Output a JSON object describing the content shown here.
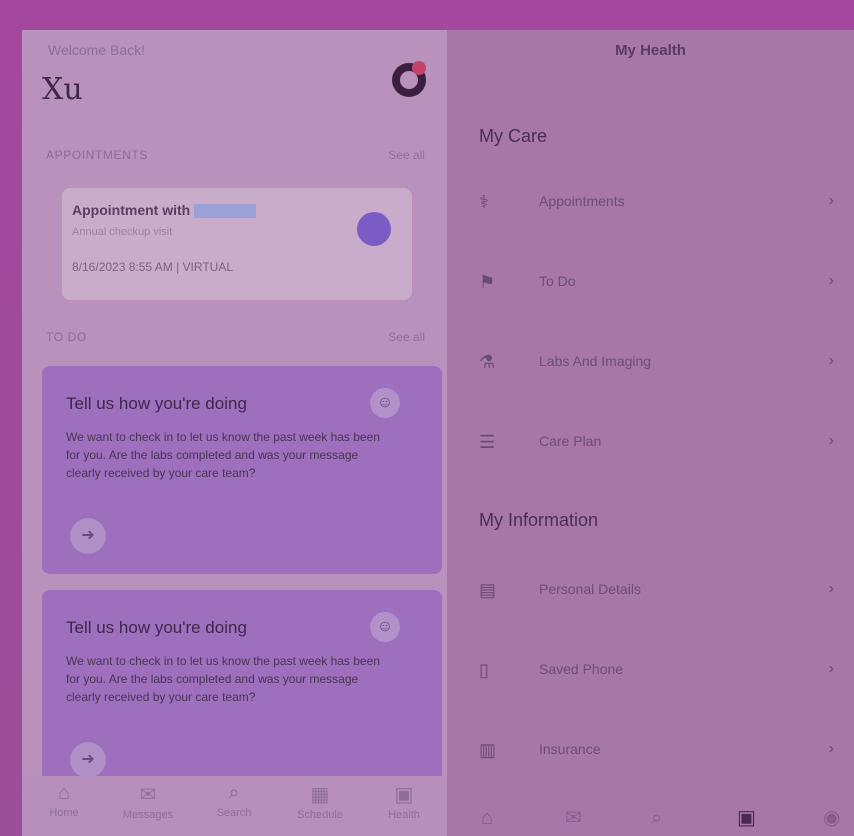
{
  "left": {
    "welcome": "Welcome Back!",
    "name": "Xu",
    "appointments_section": "APPOINTMENTS",
    "see_all": "See all",
    "appointment": {
      "title": "Appointment with",
      "subtitle": "Annual checkup visit",
      "meta": "8/16/2023 8:55 AM | VIRTUAL"
    },
    "todo_section": "TO DO",
    "todo_see_all": "See all",
    "todo_cards": [
      {
        "title": "Tell us how you're doing",
        "body": "We want to check in to let us know the past week has been for you. Are the labs completed and was your message clearly received by your care team?"
      },
      {
        "title": "Tell us how you're doing",
        "body": "We want to check in to let us know the past week has been for you. Are the labs completed and was your message clearly received by your care team?"
      }
    ],
    "tabs": [
      "Home",
      "Messages",
      "Search",
      "Schedule",
      "Health"
    ]
  },
  "right": {
    "title": "My Health",
    "care_section": "My Care",
    "care_items": [
      {
        "icon": "stethoscope-icon",
        "label": "Appointments"
      },
      {
        "icon": "flag-icon",
        "label": "To Do"
      },
      {
        "icon": "flask-icon",
        "label": "Labs And Imaging"
      },
      {
        "icon": "clipboard-icon",
        "label": "Care Plan"
      }
    ],
    "info_section": "My Information",
    "info_items": [
      {
        "icon": "id-card-icon",
        "label": "Personal Details"
      },
      {
        "icon": "phone-icon",
        "label": "Saved Phone"
      },
      {
        "icon": "insurance-icon",
        "label": "Insurance"
      }
    ],
    "tabs": [
      "home-icon",
      "messages-icon",
      "search-icon",
      "health-icon",
      "profile-icon"
    ]
  }
}
